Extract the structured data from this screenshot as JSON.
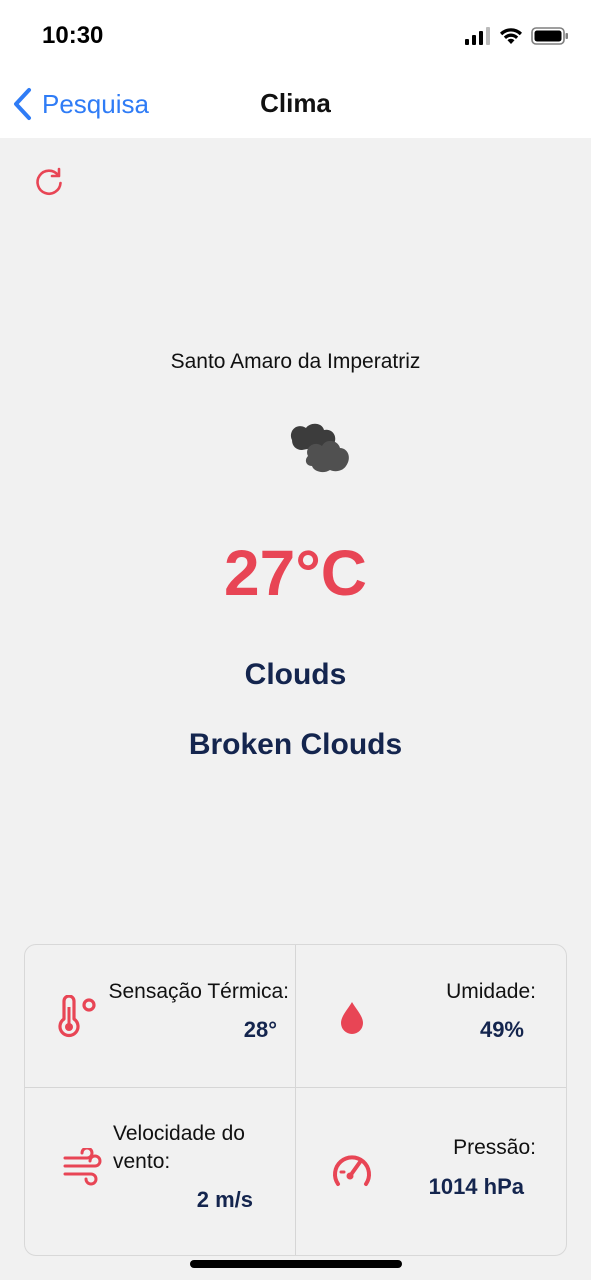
{
  "status_bar": {
    "time": "10:30"
  },
  "nav": {
    "back_label": "Pesquisa",
    "title": "Clima"
  },
  "weather": {
    "city": "Santo Amaro da Imperatriz",
    "icon": "broken-clouds-icon",
    "temperature": "27°C",
    "main": "Clouds",
    "description": "Broken Clouds"
  },
  "details": {
    "feels_like": {
      "label": "Sensação Térmica:",
      "value": "28°",
      "icon": "thermometer-icon"
    },
    "humidity": {
      "label": "Umidade:",
      "value": "49%",
      "icon": "water-drop-icon"
    },
    "wind": {
      "label_line1": "Velocidade do",
      "label_line2": "vento:",
      "value": "2 m/s",
      "icon": "wind-icon"
    },
    "pressure": {
      "label": "Pressão:",
      "value": "1014 hPa",
      "icon": "gauge-icon"
    }
  },
  "colors": {
    "accent": "#e84555",
    "navy": "#14254e",
    "link": "#2f7cf6",
    "background": "#f1f1f1"
  }
}
